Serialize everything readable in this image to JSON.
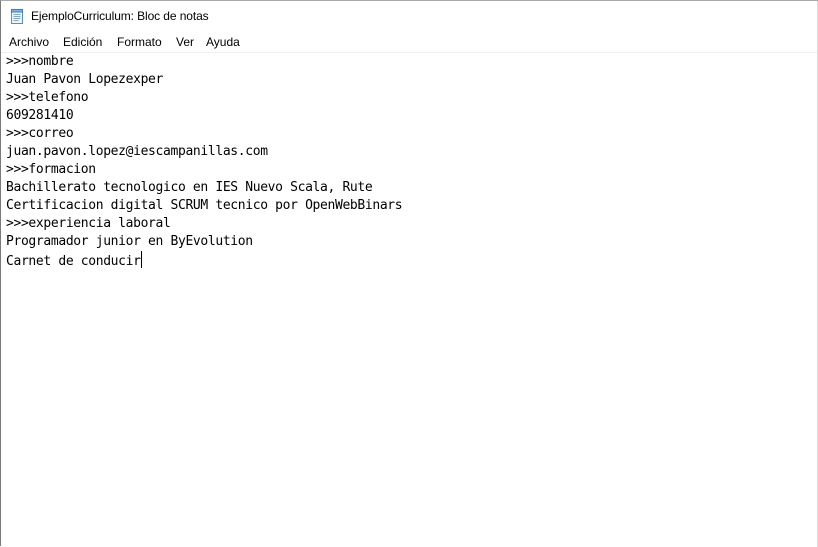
{
  "window": {
    "title": "EjemploCurriculum: Bloc de notas",
    "icon": "notepad-icon"
  },
  "menu": {
    "items": [
      {
        "label": "Archivo"
      },
      {
        "label": "Edición"
      },
      {
        "label": "Formato"
      },
      {
        "label": "Ver"
      },
      {
        "label": "Ayuda"
      }
    ]
  },
  "editor": {
    "lines": [
      ">>>nombre",
      "Juan Pavon Lopezexper",
      ">>>telefono",
      "609281410",
      ">>>correo",
      "juan.pavon.lopez@iescampanillas.com",
      ">>>formacion",
      "Bachillerato tecnologico en IES Nuevo Scala, Rute",
      "Certificacion digital SCRUM tecnico por OpenWebBinars",
      ">>>experiencia laboral",
      "Programador junior en ByEvolution",
      "Carnet de conducir"
    ]
  }
}
